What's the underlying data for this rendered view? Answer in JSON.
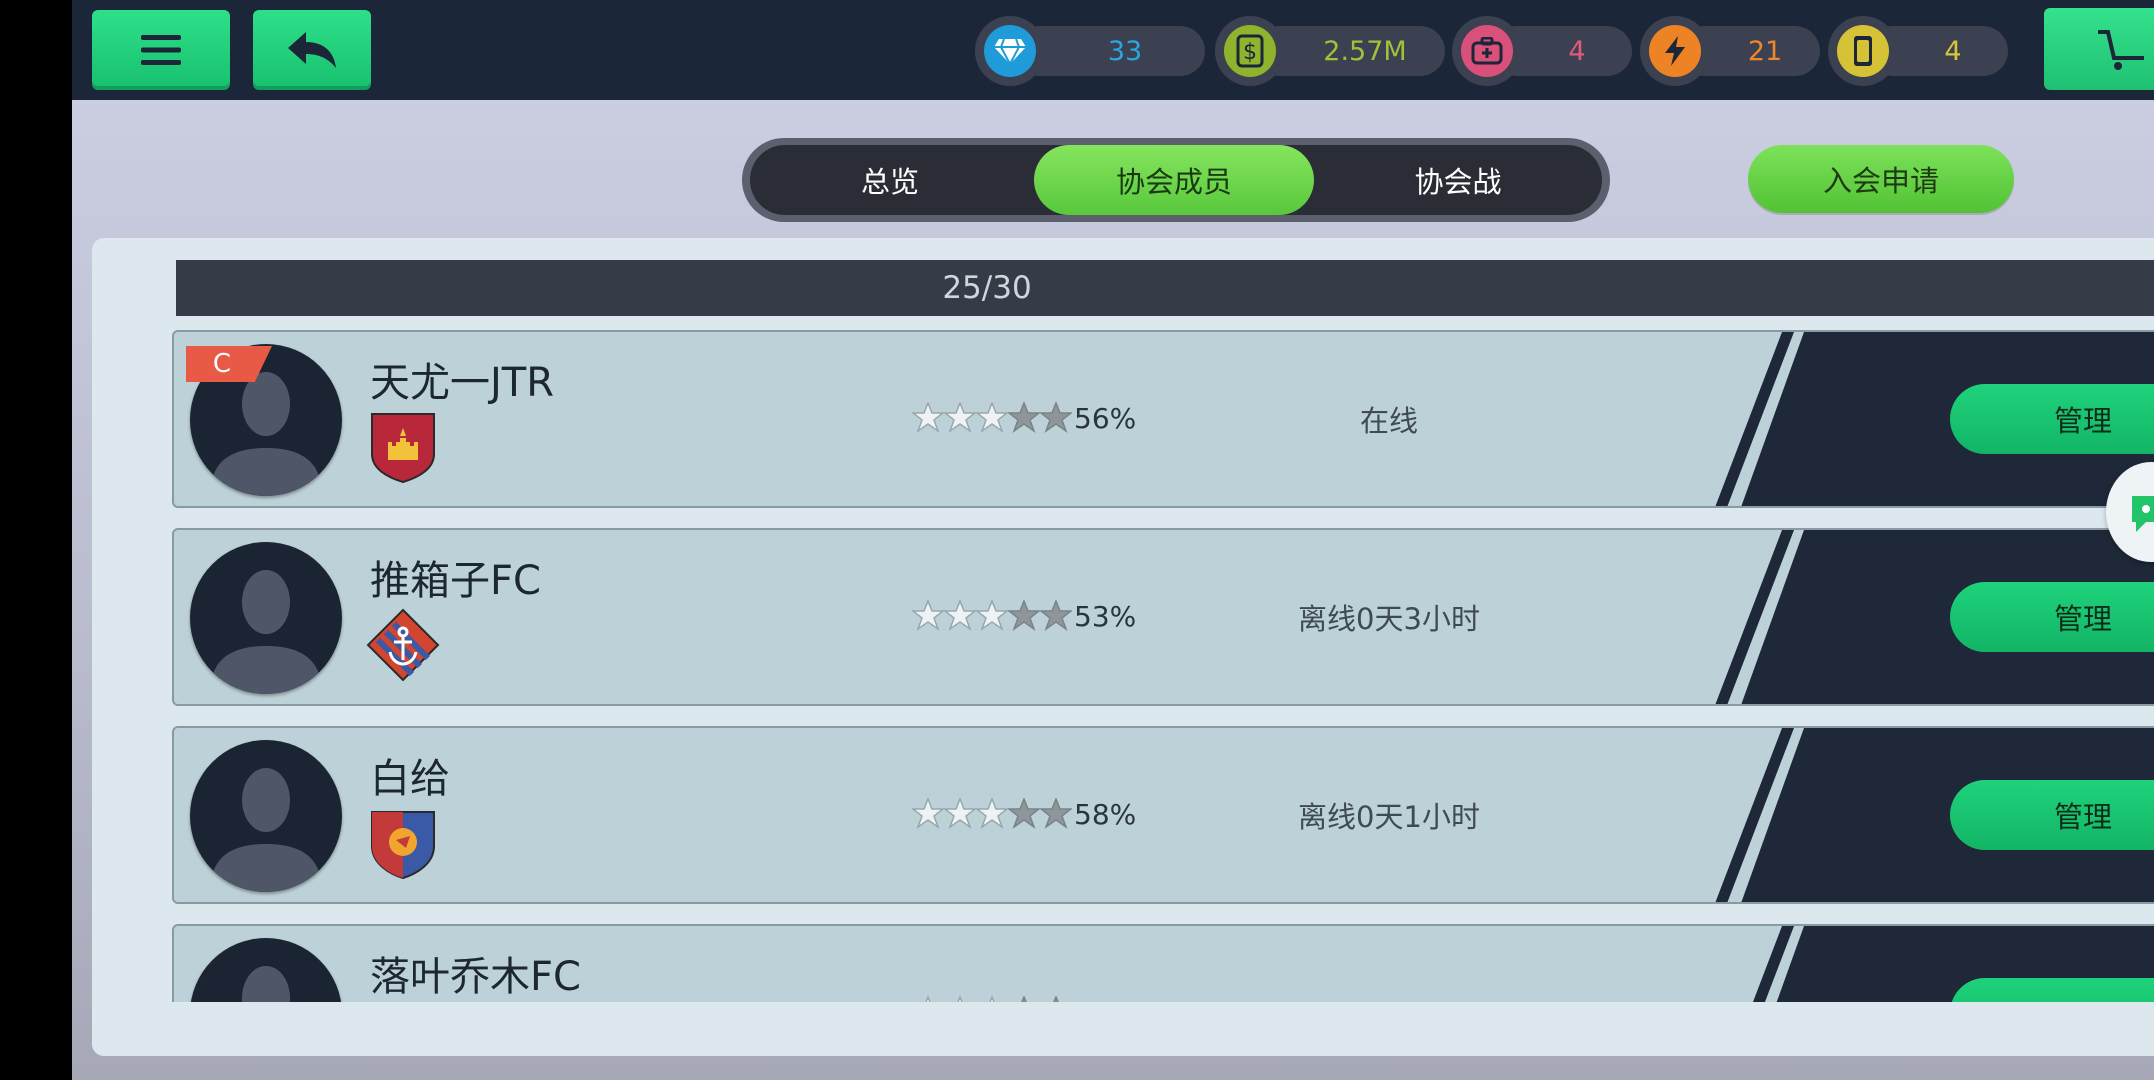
{
  "topbar": {
    "menu_icon": "hamburger-menu-icon",
    "back_icon": "back-arrow-icon",
    "resources": [
      {
        "id": "diamonds",
        "icon": "diamond-icon",
        "value": "33",
        "color": "#2aa7e2"
      },
      {
        "id": "money",
        "icon": "dollar-icon",
        "value": "2.57M",
        "color": "#9fc23a"
      },
      {
        "id": "medkit",
        "icon": "medkit-icon",
        "value": "4",
        "color": "#e05a7c"
      },
      {
        "id": "energy",
        "icon": "lightning-icon",
        "value": "21",
        "color": "#f0862a"
      },
      {
        "id": "cards",
        "icon": "card-icon",
        "value": "4",
        "color": "#d8c43a"
      }
    ],
    "shop_icon": "cart-icon"
  },
  "tabs": [
    {
      "label": "总览",
      "active": false
    },
    {
      "label": "协会成员",
      "active": true
    },
    {
      "label": "协会战",
      "active": false
    }
  ],
  "apply_button": "入会申请",
  "member_count": "25/30",
  "members": [
    {
      "name": "天尤一JTR",
      "captain_badge": "C",
      "crest": "castle-crest",
      "stars_filled": 3,
      "stars_total": 5,
      "percent": "56%",
      "status": "在线",
      "action": "管理"
    },
    {
      "name": "推箱子FC",
      "captain_badge": "",
      "crest": "anchor-crest",
      "stars_filled": 3,
      "stars_total": 5,
      "percent": "53%",
      "status": "离线0天3小时",
      "action": "管理"
    },
    {
      "name": "白给",
      "captain_badge": "",
      "crest": "dragon-crest",
      "stars_filled": 3,
      "stars_total": 5,
      "percent": "58%",
      "status": "离线0天1小时",
      "action": "管理"
    },
    {
      "name": "落叶乔木FC",
      "captain_badge": "",
      "crest": "",
      "stars_filled": 3,
      "stars_total": 5,
      "percent": "",
      "status": "",
      "action": ""
    }
  ],
  "chat_icon": "chat-bubble-icon"
}
